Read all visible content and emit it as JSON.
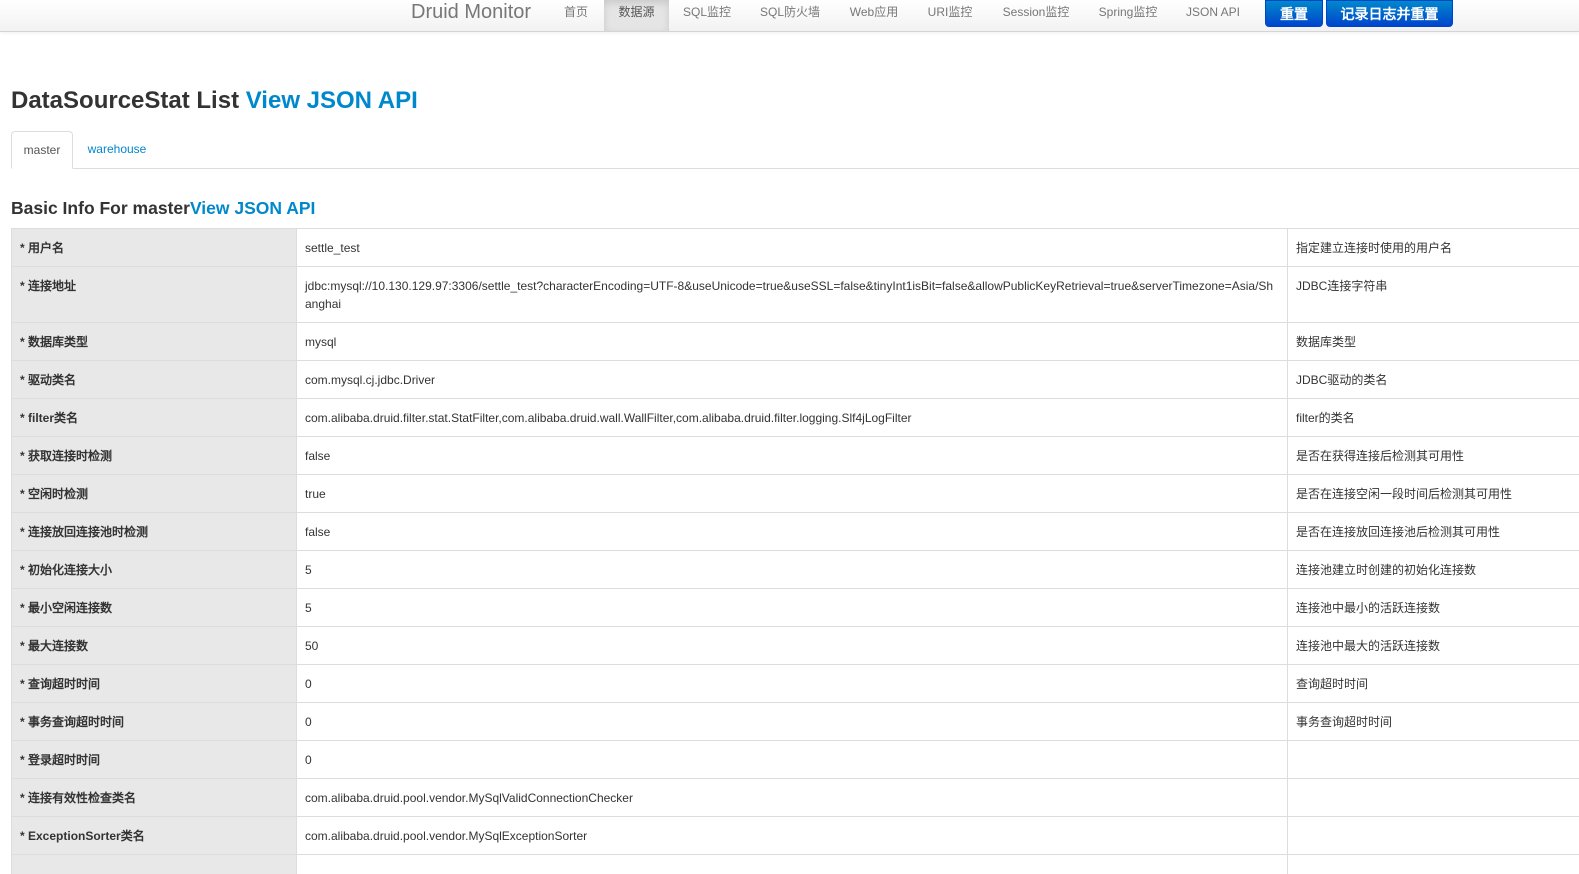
{
  "navbar": {
    "brand": "Druid Monitor",
    "items": [
      {
        "label": "首页"
      },
      {
        "label": "数据源",
        "active": true
      },
      {
        "label": "SQL监控"
      },
      {
        "label": "SQL防火墙"
      },
      {
        "label": "Web应用"
      },
      {
        "label": "URI监控"
      },
      {
        "label": "Session监控"
      },
      {
        "label": "Spring监控"
      },
      {
        "label": "JSON API"
      }
    ],
    "reset_button": "重置",
    "log_reset_button": "记录日志并重置",
    "button_color": "#0055cc"
  },
  "page": {
    "title": "DataSourceStat List",
    "title_link": "View JSON API"
  },
  "tabs": [
    {
      "label": "master",
      "active": true
    },
    {
      "label": "warehouse"
    }
  ],
  "section": {
    "title": "Basic Info For master",
    "link": "View JSON API"
  },
  "rows": [
    {
      "name": "* 用户名",
      "value": "settle_test",
      "desc": "指定建立连接时使用的用户名"
    },
    {
      "name": "* 连接地址",
      "value": "jdbc:mysql://10.130.129.97:3306/settle_test?characterEncoding=UTF-8&useUnicode=true&useSSL=false&tinyInt1isBit=false&allowPublicKeyRetrieval=true&serverTimezone=Asia/Shanghai",
      "desc": "JDBC连接字符串"
    },
    {
      "name": "* 数据库类型",
      "value": "mysql",
      "desc": "数据库类型"
    },
    {
      "name": "* 驱动类名",
      "value": "com.mysql.cj.jdbc.Driver",
      "desc": "JDBC驱动的类名"
    },
    {
      "name": "* filter类名",
      "value": "com.alibaba.druid.filter.stat.StatFilter,com.alibaba.druid.wall.WallFilter,com.alibaba.druid.filter.logging.Slf4jLogFilter",
      "desc": "filter的类名"
    },
    {
      "name": "* 获取连接时检测",
      "value": "false",
      "desc": "是否在获得连接后检测其可用性"
    },
    {
      "name": "* 空闲时检测",
      "value": "true",
      "desc": "是否在连接空闲一段时间后检测其可用性"
    },
    {
      "name": "* 连接放回连接池时检测",
      "value": "false",
      "desc": "是否在连接放回连接池后检测其可用性"
    },
    {
      "name": "* 初始化连接大小",
      "value": "5",
      "desc": "连接池建立时创建的初始化连接数"
    },
    {
      "name": "* 最小空闲连接数",
      "value": "5",
      "desc": "连接池中最小的活跃连接数"
    },
    {
      "name": "* 最大连接数",
      "value": "50",
      "desc": "连接池中最大的活跃连接数"
    },
    {
      "name": "* 查询超时时间",
      "value": "0",
      "desc": "查询超时时间"
    },
    {
      "name": "* 事务查询超时时间",
      "value": "0",
      "desc": "事务查询超时时间"
    },
    {
      "name": "* 登录超时时间",
      "value": "0",
      "desc": ""
    },
    {
      "name": "* 连接有效性检查类名",
      "value": "com.alibaba.druid.pool.vendor.MySqlValidConnectionChecker",
      "desc": ""
    },
    {
      "name": "* ExceptionSorter类名",
      "value": "com.alibaba.druid.pool.vendor.MySqlExceptionSorter",
      "desc": ""
    },
    {
      "name": "",
      "value": "",
      "desc": ""
    }
  ]
}
